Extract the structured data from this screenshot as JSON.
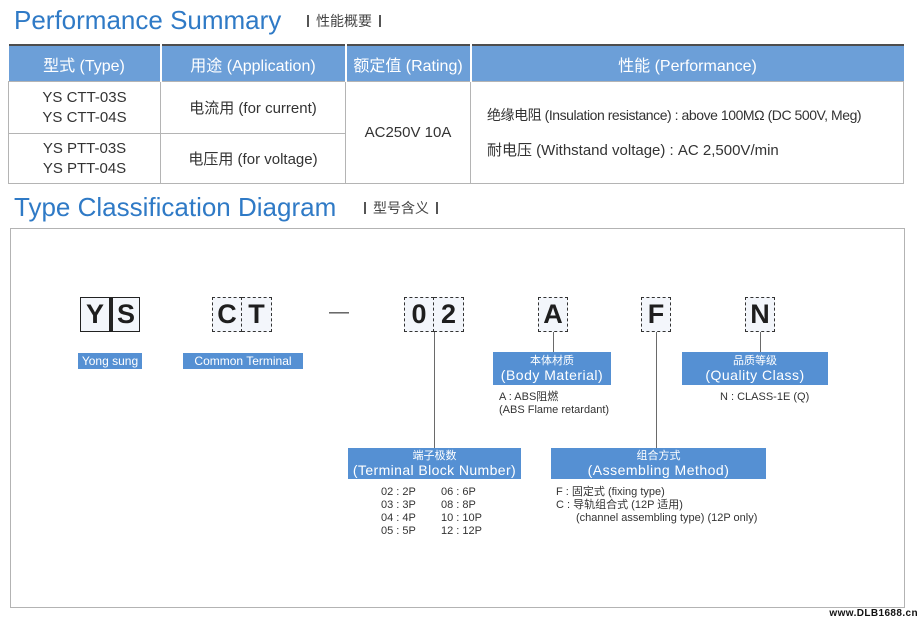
{
  "performance_summary": {
    "title": "Performance Summary",
    "subtitle": "性能概要",
    "headers": [
      "型式 (Type)",
      "用途 (Application)",
      "额定值 (Rating)",
      "性能 (Performance)"
    ],
    "rows": [
      {
        "type_lines": [
          "YS CTT-03S",
          "YS CTT-04S"
        ],
        "application": "电流用 (for current)"
      },
      {
        "type_lines": [
          "YS PTT-03S",
          "YS PTT-04S"
        ],
        "application": "电压用 (for voltage)"
      }
    ],
    "rating": "AC250V 10A",
    "performance": [
      "绝缘电阻 (Insulation resistance) : above 100MΩ (DC 500V, Meg)",
      "耐电压 (Withstand voltage) : AC 2,500V/min"
    ]
  },
  "type_classification": {
    "title": "Type Classification Diagram",
    "subtitle": "型号含义",
    "separator": "—",
    "maker": {
      "letters": [
        "Y",
        "S"
      ],
      "label": "Yong sung"
    },
    "terminal": {
      "letters": [
        "C",
        "T"
      ],
      "label": "Common Terminal"
    },
    "block_number": {
      "letters": [
        "0",
        "2"
      ],
      "label_cn": "端子极数",
      "label_en": "(Terminal Block Number)",
      "options": [
        [
          "02 : 2P",
          "06 : 6P"
        ],
        [
          "03 : 3P",
          "08 : 8P"
        ],
        [
          "04 : 4P",
          "10 : 10P"
        ],
        [
          "05 : 5P",
          "12 : 12P"
        ]
      ]
    },
    "body_material": {
      "letter": "A",
      "label_cn": "本体材质",
      "label_en": "(Body Material)",
      "notes": [
        "A : ABS阻燃",
        "(ABS Flame retardant)"
      ]
    },
    "assembling_method": {
      "letter": "F",
      "label_cn": "组合方式",
      "label_en": "(Assembling Method)",
      "notes": [
        "F : 固定式 (fixing type)",
        "C : 导轨组合式 (12P 适用)",
        "(channel assembling type) (12P only)"
      ]
    },
    "quality_class": {
      "letter": "N",
      "label_cn": "品质等级",
      "label_en": "(Quality Class)",
      "notes": [
        "N : CLASS-1E (Q)"
      ]
    }
  },
  "watermark": "www.DLB1688.cn",
  "colors": {
    "title_blue": "#2f7ac6",
    "table_header_bg": "#6c9fd8",
    "label_bg": "#5590d3",
    "border_gray": "#b4b4b4"
  }
}
